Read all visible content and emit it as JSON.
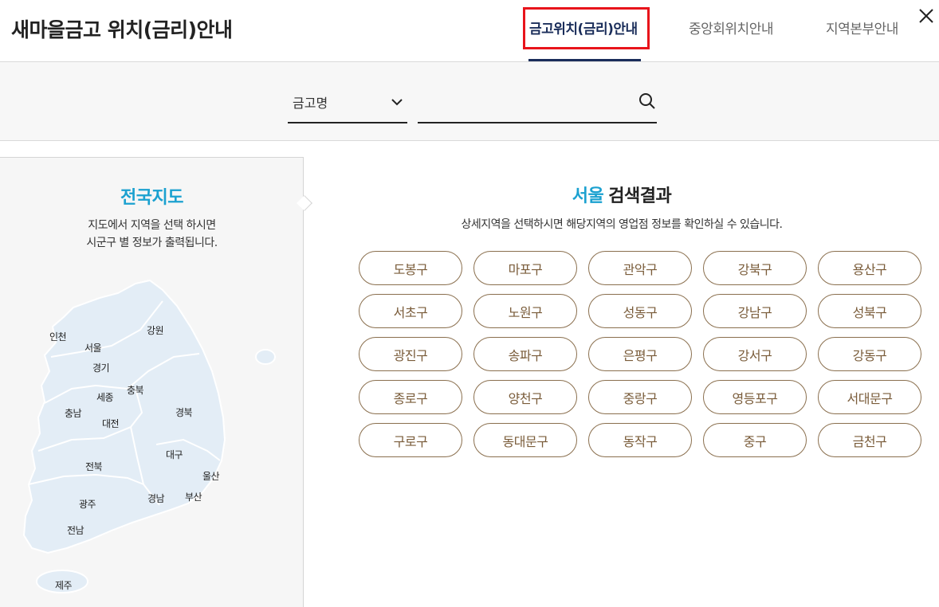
{
  "header": {
    "title": "새마을금고 위치(금리)안내",
    "tabs": [
      {
        "label": "금고위치(금리)안내",
        "active": true
      },
      {
        "label": "중앙회위치안내",
        "active": false
      },
      {
        "label": "지역본부안내",
        "active": false
      }
    ],
    "close_icon": "close-icon"
  },
  "search": {
    "select_value": "금고명",
    "input_value": "",
    "input_placeholder": "",
    "search_icon": "search-icon"
  },
  "map_panel": {
    "title": "전국지도",
    "desc_line1": "지도에서 지역을 선택 하시면",
    "desc_line2": "시군구 별 정보가 출력됩니다.",
    "regions": {
      "incheon": "인천",
      "seoul": "서울",
      "gyeonggi": "경기",
      "gangwon": "강원",
      "sejong": "세종",
      "chungbuk": "충북",
      "chungnam": "충남",
      "daejeon": "대전",
      "gyeongbuk": "경북",
      "daegu": "대구",
      "jeonbuk": "전북",
      "ulsan": "울산",
      "gwangju": "광주",
      "gyeongnam": "경남",
      "busan": "부산",
      "jeonnam": "전남",
      "jeju": "제주"
    }
  },
  "results": {
    "city": "서울",
    "title_suffix": "검색결과",
    "desc": "상세지역을 선택하시면 해당지역의 영업점 정보를 확인하실 수 있습니다.",
    "districts": [
      "도봉구",
      "마포구",
      "관악구",
      "강북구",
      "용산구",
      "서초구",
      "노원구",
      "성동구",
      "강남구",
      "성북구",
      "광진구",
      "송파구",
      "은평구",
      "강서구",
      "강동구",
      "종로구",
      "양천구",
      "중랑구",
      "영등포구",
      "서대문구",
      "구로구",
      "동대문구",
      "동작구",
      "중구",
      "금천구"
    ]
  },
  "colors": {
    "accent_blue": "#1ba1d0",
    "tab_active": "#1a2d5a",
    "highlight_red": "#e8141b",
    "district_border": "#8a6f4e",
    "district_text": "#7a5c3a",
    "map_fill": "#e3edf6"
  }
}
